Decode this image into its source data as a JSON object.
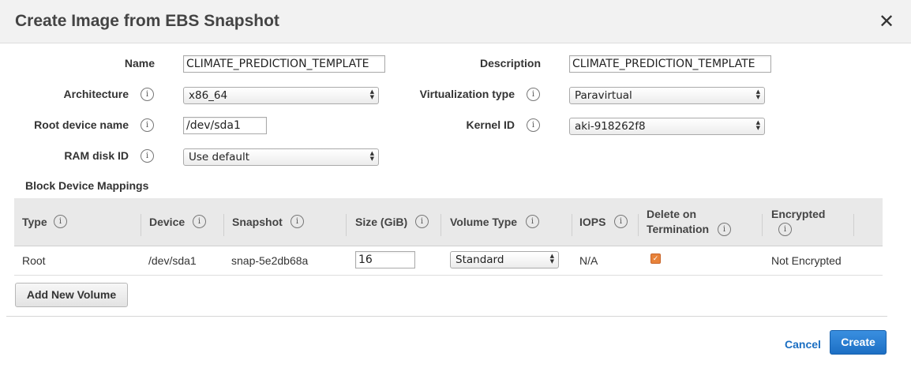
{
  "dialog": {
    "title": "Create Image from EBS Snapshot",
    "close_label": "✕"
  },
  "form": {
    "name": {
      "label": "Name",
      "value": "CLIMATE_PREDICTION_TEMPLATE"
    },
    "description": {
      "label": "Description",
      "value": "CLIMATE_PREDICTION_TEMPLATE"
    },
    "architecture": {
      "label": "Architecture",
      "value": "x86_64"
    },
    "virtualization_type": {
      "label": "Virtualization type",
      "value": "Paravirtual"
    },
    "root_device_name": {
      "label": "Root device name",
      "value": "/dev/sda1"
    },
    "kernel_id": {
      "label": "Kernel ID",
      "value": "aki-918262f8"
    },
    "ram_disk_id": {
      "label": "RAM disk ID",
      "value": "Use default"
    }
  },
  "block_device": {
    "section_title": "Block Device Mappings",
    "columns": {
      "type": "Type",
      "device": "Device",
      "snapshot": "Snapshot",
      "size": "Size (GiB)",
      "volume_type": "Volume Type",
      "iops": "IOPS",
      "delete_line1": "Delete on",
      "delete_line2": "Termination",
      "encrypted": "Encrypted"
    },
    "rows": [
      {
        "type": "Root",
        "device": "/dev/sda1",
        "snapshot": "snap-5e2db68a",
        "size": "16",
        "volume_type": "Standard",
        "iops": "N/A",
        "delete_on_termination": true,
        "encrypted": "Not Encrypted"
      }
    ],
    "add_button": "Add New Volume"
  },
  "footer": {
    "cancel": "Cancel",
    "create": "Create"
  },
  "icons": {
    "info": "i",
    "check": "✓",
    "select_arrows": "▲▼"
  },
  "colors": {
    "primary": "#1d6fc4",
    "link": "#1a6ec2",
    "checkbox": "#e8833a",
    "header_bg": "#f2f2f2",
    "table_header_bg": "#e9e9e9"
  }
}
